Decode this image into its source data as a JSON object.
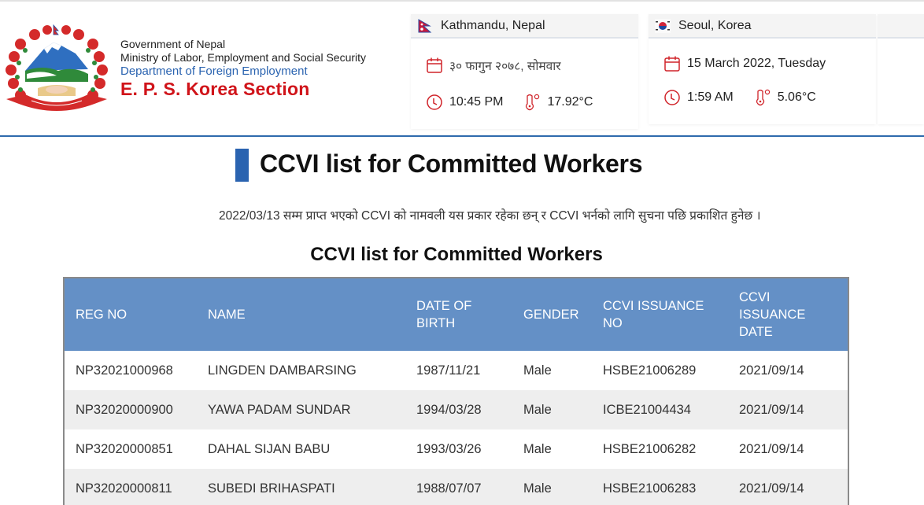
{
  "header": {
    "gov_line1": "Government of Nepal",
    "gov_line2": "Ministry of Labor, Employment and Social Security",
    "department": "Department of Foreign Employment",
    "section": "E. P. S. Korea Section",
    "emblem_icon": "nepal-emblem-icon",
    "colors": {
      "brand_red": "#d0141a",
      "brand_blue": "#2a63b0"
    }
  },
  "cities": [
    {
      "name": "Kathmandu, Nepal",
      "flag_icon": "nepal-flag-icon",
      "date": "३० फागुन २०७८, सोमवार",
      "time": "10:45 PM",
      "temperature": "17.92°C"
    },
    {
      "name": "Seoul, Korea",
      "flag_icon": "korea-flag-icon",
      "date": "15 March 2022, Tuesday",
      "time": "1:59 AM",
      "temperature": "5.06°C"
    }
  ],
  "main": {
    "title": "CCVI list for Committed Workers",
    "notice": "2022/03/13  सम्म प्राप्त भएको CCVI को नामवली यस प्रकार रहेका छन् र CCVI भर्नको लागि सुचना पछि प्रकाशित हुनेछ ।",
    "table_title": "CCVI list for Committed Workers"
  },
  "table": {
    "columns": [
      "REG NO",
      "NAME",
      "DATE OF BIRTH",
      "GENDER",
      "CCVI ISSUANCE NO",
      "CCVI ISSUANCE DATE"
    ],
    "header_color": "#6490c6",
    "rows": [
      [
        "NP32021000968",
        "LINGDEN DAMBARSING",
        "1987/11/21",
        "Male",
        "HSBE21006289",
        "2021/09/14"
      ],
      [
        "NP32020000900",
        "YAWA PADAM SUNDAR",
        "1994/03/28",
        "Male",
        "ICBE21004434",
        "2021/09/14"
      ],
      [
        "NP32020000851",
        "DAHAL SIJAN BABU",
        "1993/03/26",
        "Male",
        "HSBE21006282",
        "2021/09/14"
      ],
      [
        "NP32020000811",
        "SUBEDI BRIHASPATI",
        "1988/07/07",
        "Male",
        "HSBE21006283",
        "2021/09/14"
      ]
    ]
  }
}
